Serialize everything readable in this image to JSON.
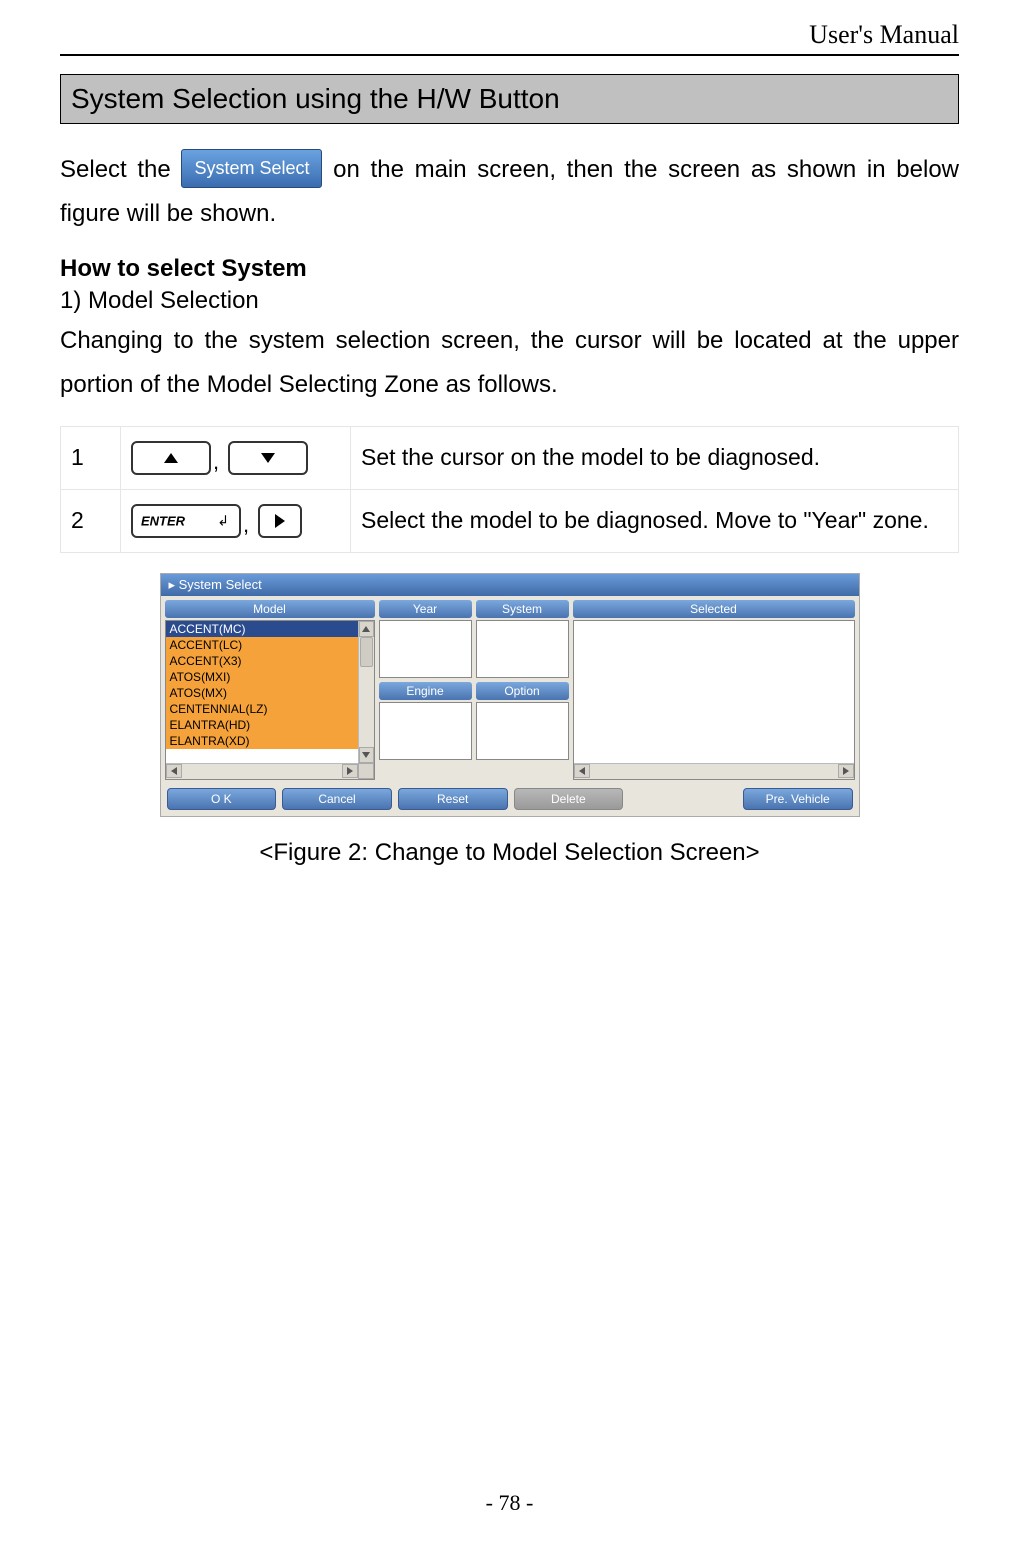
{
  "header": "User's Manual",
  "section_title": "System Selection using the H/W Button",
  "intro": {
    "before": "Select the ",
    "button_label": "System Select",
    "after": " on the main screen, then the screen as shown in below figure will be shown."
  },
  "how_to_heading": "How to select System",
  "step1_title": "1) Model Selection",
  "step1_text": "Changing to the system selection screen, the cursor will be located at the upper portion of the Model Selecting Zone as follows.",
  "table": {
    "rows": [
      {
        "num": "1",
        "desc": "Set the cursor on the model to be diagnosed."
      },
      {
        "num": "2",
        "desc": "Select the model to be diagnosed. Move to \"Year\" zone."
      }
    ],
    "enter_label": "ENTER"
  },
  "screenshot": {
    "title": "System Select",
    "col_model": "Model",
    "col_year": "Year",
    "col_system": "System",
    "col_engine": "Engine",
    "col_option": "Option",
    "col_selected": "Selected",
    "models": [
      "ACCENT(MC)",
      "ACCENT(LC)",
      "ACCENT(X3)",
      "ATOS(MXI)",
      "ATOS(MX)",
      "CENTENNIAL(LZ)",
      "ELANTRA(HD)",
      "ELANTRA(XD)"
    ],
    "buttons": {
      "ok": "O K",
      "cancel": "Cancel",
      "reset": "Reset",
      "delete": "Delete",
      "prev": "Pre. Vehicle"
    }
  },
  "figure_caption": "<Figure 2: Change to Model Selection Screen>",
  "page_number": "- 78 -"
}
